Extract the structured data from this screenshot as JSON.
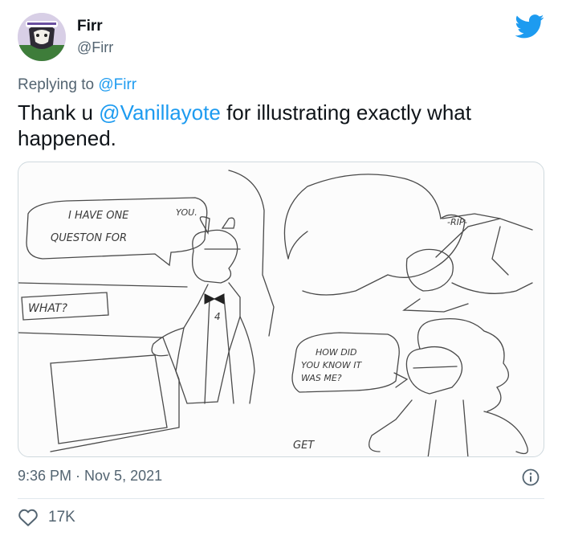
{
  "header": {
    "name": "Firr",
    "handle": "@Firr",
    "logo_icon": "twitter-bird-icon",
    "brand_color": "#1d9bf0"
  },
  "reply": {
    "prefix": "Replying to ",
    "target": "@Firr"
  },
  "tweet": {
    "text_before": "Thank u ",
    "mention": "@Vanillayote",
    "text_after": " for illustrating exactly what happened."
  },
  "media": {
    "bubble_1": [
      "I HAVE ONE",
      "QUESTON FOR",
      "YOU."
    ],
    "bubble_2": "WHAT?",
    "bubble_3": "-RIP-",
    "bubble_4": [
      "HOW DID",
      "YOU KNOW IT",
      "WAS ME?"
    ],
    "bubble_5": "GET",
    "jersey": "4"
  },
  "meta": {
    "time": "9:36 PM",
    "separator": " · ",
    "date": "Nov 5, 2021",
    "info_icon": "info-icon"
  },
  "actions": {
    "like_icon": "heart-icon",
    "likes": "17K"
  }
}
